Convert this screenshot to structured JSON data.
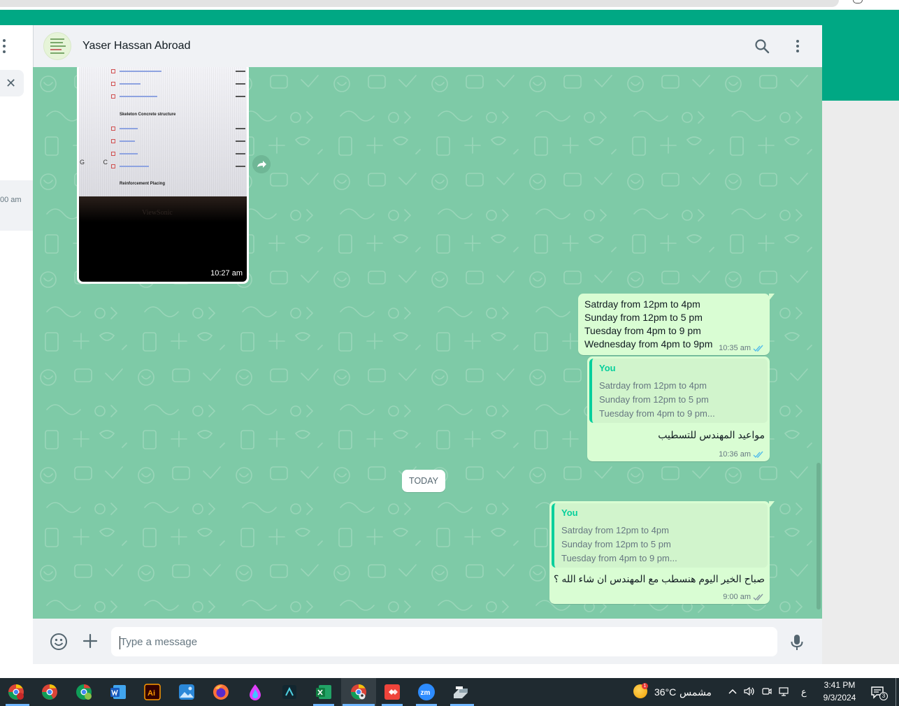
{
  "chat": {
    "contact_name": "Yaser Hassan Abroad"
  },
  "left_panel": {
    "partial_time": "00 am"
  },
  "image_message": {
    "time": "10:27 am",
    "screen_sections": [
      "Skeleton Concrete structure",
      "Reinforcement Placing"
    ],
    "brand": "ViewSonic",
    "edge_letters": "G C"
  },
  "messages": [
    {
      "lines": [
        "Satrday from 12pm to 4pm",
        "Sunday from 12pm to 5 pm",
        "Tuesday from 4pm to 9 pm",
        "Wednesday from 4pm to 9pm"
      ],
      "time": "10:35 am",
      "status": "read"
    },
    {
      "quote": {
        "author": "You",
        "lines": [
          "Satrday from 12pm to 4pm",
          "Sunday from 12pm to 5 pm",
          "Tuesday from 4pm to 9 pm..."
        ]
      },
      "text": "مواعيد المهندس للتسطيب",
      "time": "10:36 am",
      "status": "read"
    },
    {
      "quote": {
        "author": "You",
        "lines": [
          "Satrday from 12pm to 4pm",
          "Sunday from 12pm to 5 pm",
          "Tuesday from 4pm to 9 pm..."
        ]
      },
      "text": "صباح الخير اليوم هنسطب مع المهندس ان شاء الله ؟",
      "time": "9:00 am",
      "status": "delivered"
    }
  ],
  "date_chip": "TODAY",
  "composer": {
    "placeholder": "Type a message"
  },
  "taskbar": {
    "apps": [
      "chrome-profile",
      "chrome",
      "chrome-alt",
      "word",
      "illustrator",
      "photos",
      "firefox",
      "ink-drop",
      "app-dark",
      "excel",
      "chrome-active",
      "anydesk",
      "zoom",
      "scanner"
    ],
    "weather_temp": "36°C",
    "weather_condition": "مشمس",
    "weather_badge": "1",
    "language": "ع",
    "clock_time": "3:41 PM",
    "clock_date": "9/3/2024",
    "notification_count": "3"
  },
  "colors": {
    "accent": "#00a884",
    "outgoing_bubble": "#d9fdd3",
    "chat_bg": "#7ecaa7",
    "read_tick": "#53bdeb"
  }
}
